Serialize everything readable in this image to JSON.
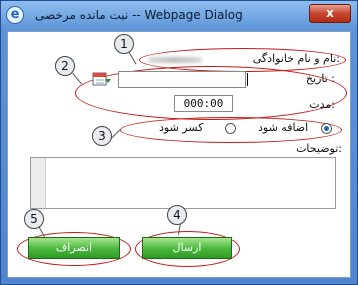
{
  "window": {
    "title": "نبت مانده مرخصی -- Webpage Dialog",
    "close_symbol": "x",
    "app_icon": "e"
  },
  "form": {
    "name_label": "نام و نام خانوادگی:",
    "date_label": "تاریخ :",
    "duration_label": "مدت:",
    "duration_value": "000:00",
    "calendar_icon": "calendar-icon",
    "radio_add_label": "اضافه شود",
    "radio_subtract_label": "کسر شود",
    "description_label": "توضیحات:",
    "send_button": "ارسال",
    "cancel_button": "انصراف"
  },
  "annotations": [
    "1",
    "2",
    "3",
    "4",
    "5"
  ],
  "colors": {
    "callout": "#c41a1a",
    "button_green": "#48b63a",
    "radio_selected": "#1c64c8"
  }
}
